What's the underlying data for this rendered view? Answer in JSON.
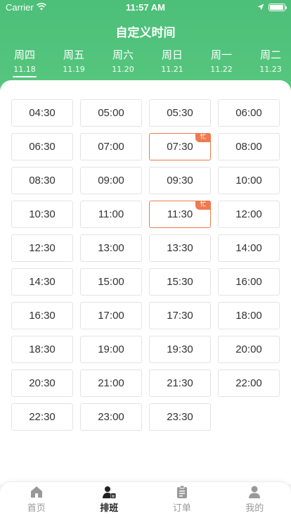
{
  "status_bar": {
    "carrier": "Carrier",
    "time": "11:57 AM"
  },
  "page_title": "自定义时间",
  "days": [
    {
      "name": "周四",
      "date": "11.18",
      "active": true
    },
    {
      "name": "周五",
      "date": "11.19",
      "active": false
    },
    {
      "name": "周六",
      "date": "11.20",
      "active": false
    },
    {
      "name": "周日",
      "date": "11.21",
      "active": false
    },
    {
      "name": "周一",
      "date": "11.22",
      "active": false
    },
    {
      "name": "周二",
      "date": "11.23",
      "active": false
    }
  ],
  "busy_label": "忙",
  "slots": [
    {
      "time": "04:30",
      "busy": false
    },
    {
      "time": "05:00",
      "busy": false
    },
    {
      "time": "05:30",
      "busy": false
    },
    {
      "time": "06:00",
      "busy": false
    },
    {
      "time": "06:30",
      "busy": false
    },
    {
      "time": "07:00",
      "busy": false
    },
    {
      "time": "07:30",
      "busy": true
    },
    {
      "time": "08:00",
      "busy": false
    },
    {
      "time": "08:30",
      "busy": false
    },
    {
      "time": "09:00",
      "busy": false
    },
    {
      "time": "09:30",
      "busy": false
    },
    {
      "time": "10:00",
      "busy": false
    },
    {
      "time": "10:30",
      "busy": false
    },
    {
      "time": "11:00",
      "busy": false
    },
    {
      "time": "11:30",
      "busy": true
    },
    {
      "time": "12:00",
      "busy": false
    },
    {
      "time": "12:30",
      "busy": false
    },
    {
      "time": "13:00",
      "busy": false
    },
    {
      "time": "13:30",
      "busy": false
    },
    {
      "time": "14:00",
      "busy": false
    },
    {
      "time": "14:30",
      "busy": false
    },
    {
      "time": "15:00",
      "busy": false
    },
    {
      "time": "15:30",
      "busy": false
    },
    {
      "time": "16:00",
      "busy": false
    },
    {
      "time": "16:30",
      "busy": false
    },
    {
      "time": "17:00",
      "busy": false
    },
    {
      "time": "17:30",
      "busy": false
    },
    {
      "time": "18:00",
      "busy": false
    },
    {
      "time": "18:30",
      "busy": false
    },
    {
      "time": "19:00",
      "busy": false
    },
    {
      "time": "19:30",
      "busy": false
    },
    {
      "time": "20:00",
      "busy": false
    },
    {
      "time": "20:30",
      "busy": false
    },
    {
      "time": "21:00",
      "busy": false
    },
    {
      "time": "21:30",
      "busy": false
    },
    {
      "time": "22:00",
      "busy": false
    },
    {
      "time": "22:30",
      "busy": false
    },
    {
      "time": "23:00",
      "busy": false
    },
    {
      "time": "23:30",
      "busy": false
    }
  ],
  "tabbar": [
    {
      "label": "首页",
      "icon": "home-icon",
      "active": false
    },
    {
      "label": "排班",
      "icon": "schedule-icon",
      "active": true
    },
    {
      "label": "订单",
      "icon": "order-icon",
      "active": false
    },
    {
      "label": "我的",
      "icon": "profile-icon",
      "active": false
    }
  ],
  "colors": {
    "header_green": "#4cbf78",
    "busy_orange": "#ee7a4e",
    "tab_inactive": "#999999",
    "tab_active": "#222222"
  }
}
